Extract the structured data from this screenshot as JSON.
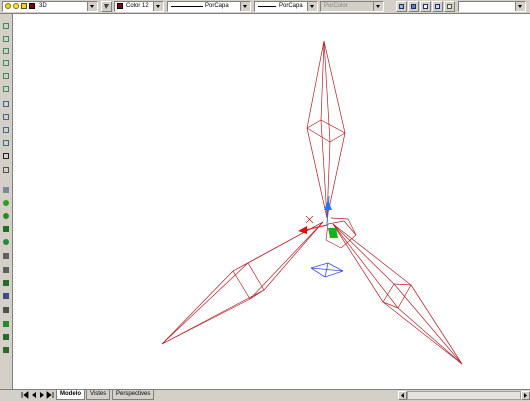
{
  "toolbar": {
    "layer_name": "3D",
    "color_value": "Color 12",
    "linetype_value": "PorCapa",
    "lineweight_value": "PorCapa",
    "plotstyle_value": "PorColor"
  },
  "tabs": [
    {
      "label": "Modelo",
      "active": true
    },
    {
      "label": "Vistes",
      "active": false
    },
    {
      "label": "Perspectives",
      "active": false
    }
  ],
  "colors": {
    "wire": "#b0202a",
    "ucs_plan": "#3a50d8",
    "axis_x": "#dd1111",
    "axis_y": "#18b018",
    "axis_z": "#2277ee",
    "layer_swatch": "#800000"
  },
  "icons": {
    "left_toolbar": [
      "view-top-icon",
      "view-bottom-icon",
      "view-left-icon",
      "view-right-icon",
      "view-front-icon",
      "view-back-icon",
      "view-sw-iso-icon",
      "view-se-iso-icon",
      "view-ne-iso-icon",
      "view-nw-iso-icon",
      "camera-icon",
      "3d-orbit-icon",
      "box-icon",
      "sphere-icon",
      "cone-icon",
      "cylinder-icon",
      "torus-icon",
      "zoom-icon",
      "pan-icon",
      "shade-icon",
      "render-icon",
      "light-icon",
      "material-icon",
      "scene-icon",
      "landscape-icon"
    ]
  }
}
